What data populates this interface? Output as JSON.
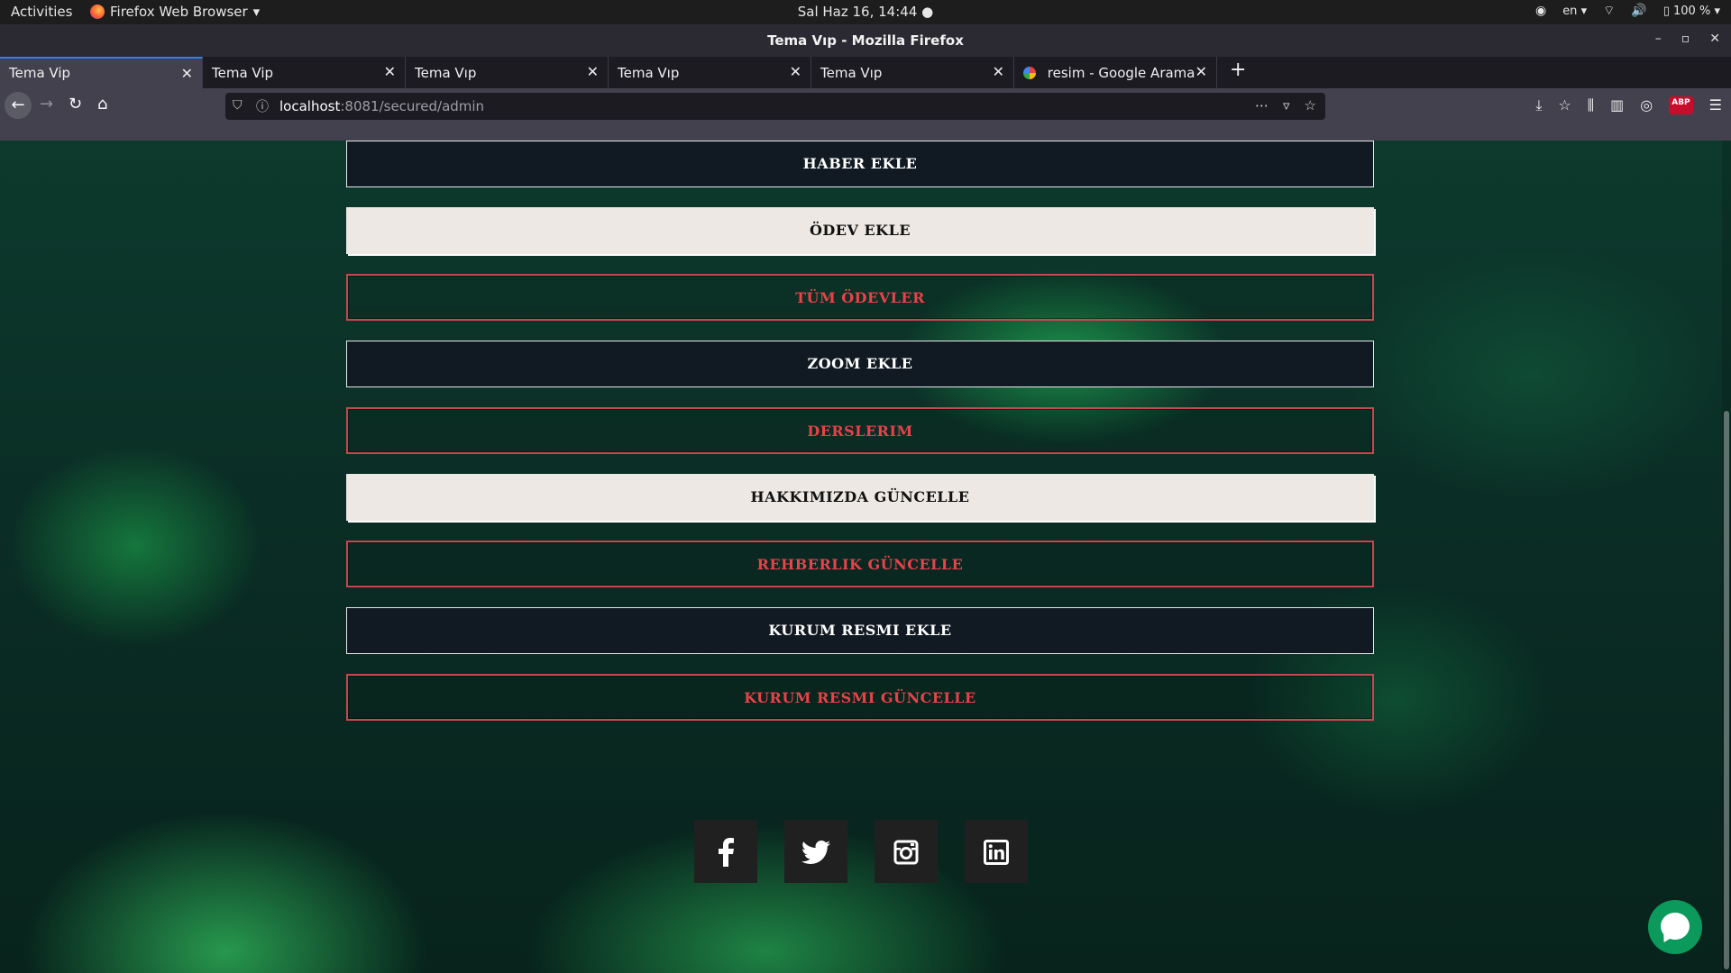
{
  "system_bar": {
    "activities": "Activities",
    "app_name": "Firefox Web Browser",
    "clock": "Sal Haz 16, 14:44",
    "language": "en",
    "battery": "100 %"
  },
  "window": {
    "title": "Tema Vıp - Mozilla Firefox"
  },
  "tabs": [
    {
      "label": "Tema Vip"
    },
    {
      "label": "Tema Vip"
    },
    {
      "label": "Tema Vıp"
    },
    {
      "label": "Tema Vıp"
    },
    {
      "label": "Tema Vıp"
    },
    {
      "label": "resim - Google Arama"
    }
  ],
  "address_bar": {
    "host": "localhost",
    "rest": ":8081/secured/admin"
  },
  "menu_buttons": [
    {
      "label": "HABER EKLE",
      "style": "dark"
    },
    {
      "label": "ÖDEV EKLE",
      "style": "light"
    },
    {
      "label": "TÜM ÖDEVLER",
      "style": "red"
    },
    {
      "label": "ZOOM EKLE",
      "style": "dark"
    },
    {
      "label": "DERSLERIM",
      "style": "red"
    },
    {
      "label": "HAKKIMIZDA GÜNCELLE",
      "style": "light"
    },
    {
      "label": "REHBERLIK GÜNCELLE",
      "style": "red"
    },
    {
      "label": "KURUM RESMI EKLE",
      "style": "dark"
    },
    {
      "label": "KURUM RESMI GÜNCELLE",
      "style": "red"
    }
  ],
  "social_icons": [
    "facebook-icon",
    "twitter-icon",
    "instagram-icon",
    "linkedin-icon"
  ],
  "colors": {
    "accent_red": "#e8424a",
    "button_dark": "#111a22",
    "button_light": "#ede8e3",
    "chat_green": "#0b9a5b"
  }
}
